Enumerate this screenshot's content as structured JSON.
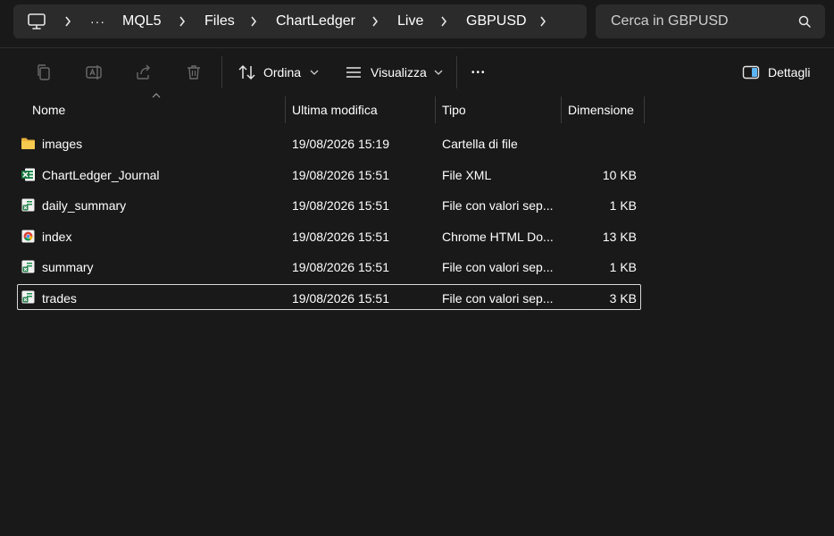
{
  "breadcrumb": {
    "overflow": "···",
    "items": [
      "MQL5",
      "Files",
      "ChartLedger",
      "Live",
      "GBPUSD"
    ]
  },
  "search": {
    "placeholder": "Cerca in GBPUSD"
  },
  "toolbar": {
    "sort_label": "Ordina",
    "view_label": "Visualizza",
    "more_label": "•••",
    "details_label": "Dettagli"
  },
  "columns": {
    "name": "Nome",
    "modified": "Ultima modifica",
    "type": "Tipo",
    "size": "Dimensione"
  },
  "files": [
    {
      "name": "images",
      "modified": "19/08/2026 15:19",
      "type": "Cartella di file",
      "size": "",
      "icon": "folder-icon"
    },
    {
      "name": "ChartLedger_Journal",
      "modified": "19/08/2026 15:51",
      "type": "File XML",
      "size": "10 KB",
      "icon": "excel-file-icon"
    },
    {
      "name": "daily_summary",
      "modified": "19/08/2026 15:51",
      "type": "File con valori sep...",
      "size": "1 KB",
      "icon": "csv-file-icon"
    },
    {
      "name": "index",
      "modified": "19/08/2026 15:51",
      "type": "Chrome HTML Do...",
      "size": "13 KB",
      "icon": "chrome-html-icon"
    },
    {
      "name": "summary",
      "modified": "19/08/2026 15:51",
      "type": "File con valori sep...",
      "size": "1 KB",
      "icon": "csv-file-icon"
    },
    {
      "name": "trades",
      "modified": "19/08/2026 15:51",
      "type": "File con valori sep...",
      "size": "3 KB",
      "icon": "csv-file-icon"
    }
  ],
  "colors": {
    "background": "#191919",
    "bar": "#2b2b2b",
    "folder": "#f2c14e",
    "excel_green": "#1f8f4e",
    "details_accent": "#5ab4f5"
  }
}
